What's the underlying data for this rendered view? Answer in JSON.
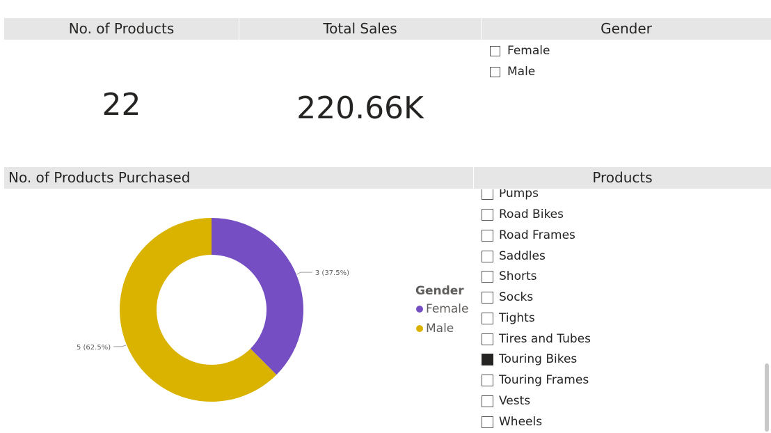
{
  "cards": {
    "products": {
      "title": "No. of Products",
      "value": "22"
    },
    "sales": {
      "title": "Total Sales",
      "value": "220.66K"
    }
  },
  "gender_slicer": {
    "title": "Gender",
    "items": [
      {
        "label": "Female",
        "checked": false
      },
      {
        "label": "Male",
        "checked": false
      }
    ]
  },
  "donut": {
    "title": "No. of Products Purchased",
    "legend": {
      "title": "Gender",
      "items": [
        {
          "label": "Female",
          "color": "#744ec2"
        },
        {
          "label": "Male",
          "color": "#d9b300"
        }
      ]
    },
    "labels": {
      "female": "3 (37.5%)",
      "male": "5 (62.5%)"
    }
  },
  "products_slicer": {
    "title": "Products",
    "items": [
      {
        "label": "Pumps",
        "checked": false
      },
      {
        "label": "Road Bikes",
        "checked": false
      },
      {
        "label": "Road Frames",
        "checked": false
      },
      {
        "label": "Saddles",
        "checked": false
      },
      {
        "label": "Shorts",
        "checked": false
      },
      {
        "label": "Socks",
        "checked": false
      },
      {
        "label": "Tights",
        "checked": false
      },
      {
        "label": "Tires and Tubes",
        "checked": false
      },
      {
        "label": "Touring Bikes",
        "checked": true
      },
      {
        "label": "Touring Frames",
        "checked": false
      },
      {
        "label": "Vests",
        "checked": false
      },
      {
        "label": "Wheels",
        "checked": false
      }
    ]
  },
  "chart_data": {
    "type": "pie",
    "variant": "donut",
    "title": "No. of Products Purchased",
    "legend_title": "Gender",
    "legend_position": "right",
    "categories": [
      "Female",
      "Male"
    ],
    "values": [
      3,
      5
    ],
    "percentages": [
      37.5,
      62.5
    ],
    "data_labels": [
      "3 (37.5%)",
      "5 (62.5%)"
    ],
    "colors": [
      "#744ec2",
      "#d9b300"
    ]
  }
}
